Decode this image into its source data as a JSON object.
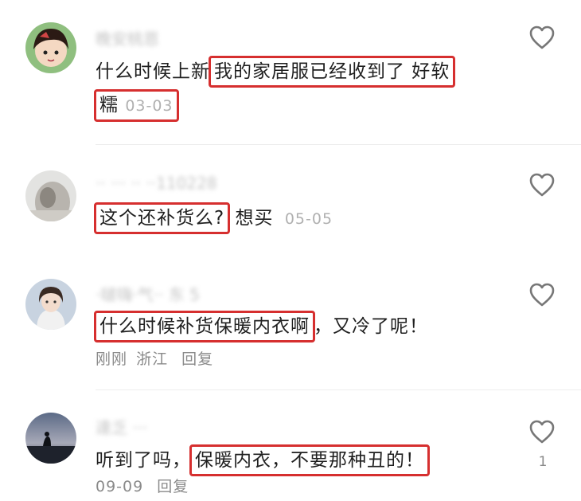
{
  "comments": [
    {
      "username": "晚安桃恩",
      "text_plain": "什么时候上新",
      "text_highlight": "我的家居服已经收到了 好软",
      "text_highlight2": "糯",
      "time": "03-03",
      "reply": "",
      "likes": ""
    },
    {
      "username": "·· ··· ·· ··110228",
      "text_highlight": "这个还补货么?",
      "text_plain": " 想买",
      "time": "05-05",
      "reply": "",
      "likes": ""
    },
    {
      "username": "·啵嗨·气·· 东 5",
      "text_highlight": "什么时候补货保暖内衣啊",
      "text_plain": "，又冷了呢！",
      "time": "刚刚",
      "location": "浙江",
      "reply": "回复",
      "likes": ""
    },
    {
      "username": "達乏 ···",
      "text_plain": "听到了吗，",
      "text_highlight": "保暖内衣，不要那种丑的！",
      "time": "09-09",
      "reply": "回复",
      "likes": "1"
    }
  ],
  "colors": {
    "highlight_border": "#d62f2f",
    "meta": "#b0b0b0",
    "heart": "#777777"
  },
  "icons": {
    "like": "heart-outline-icon"
  }
}
